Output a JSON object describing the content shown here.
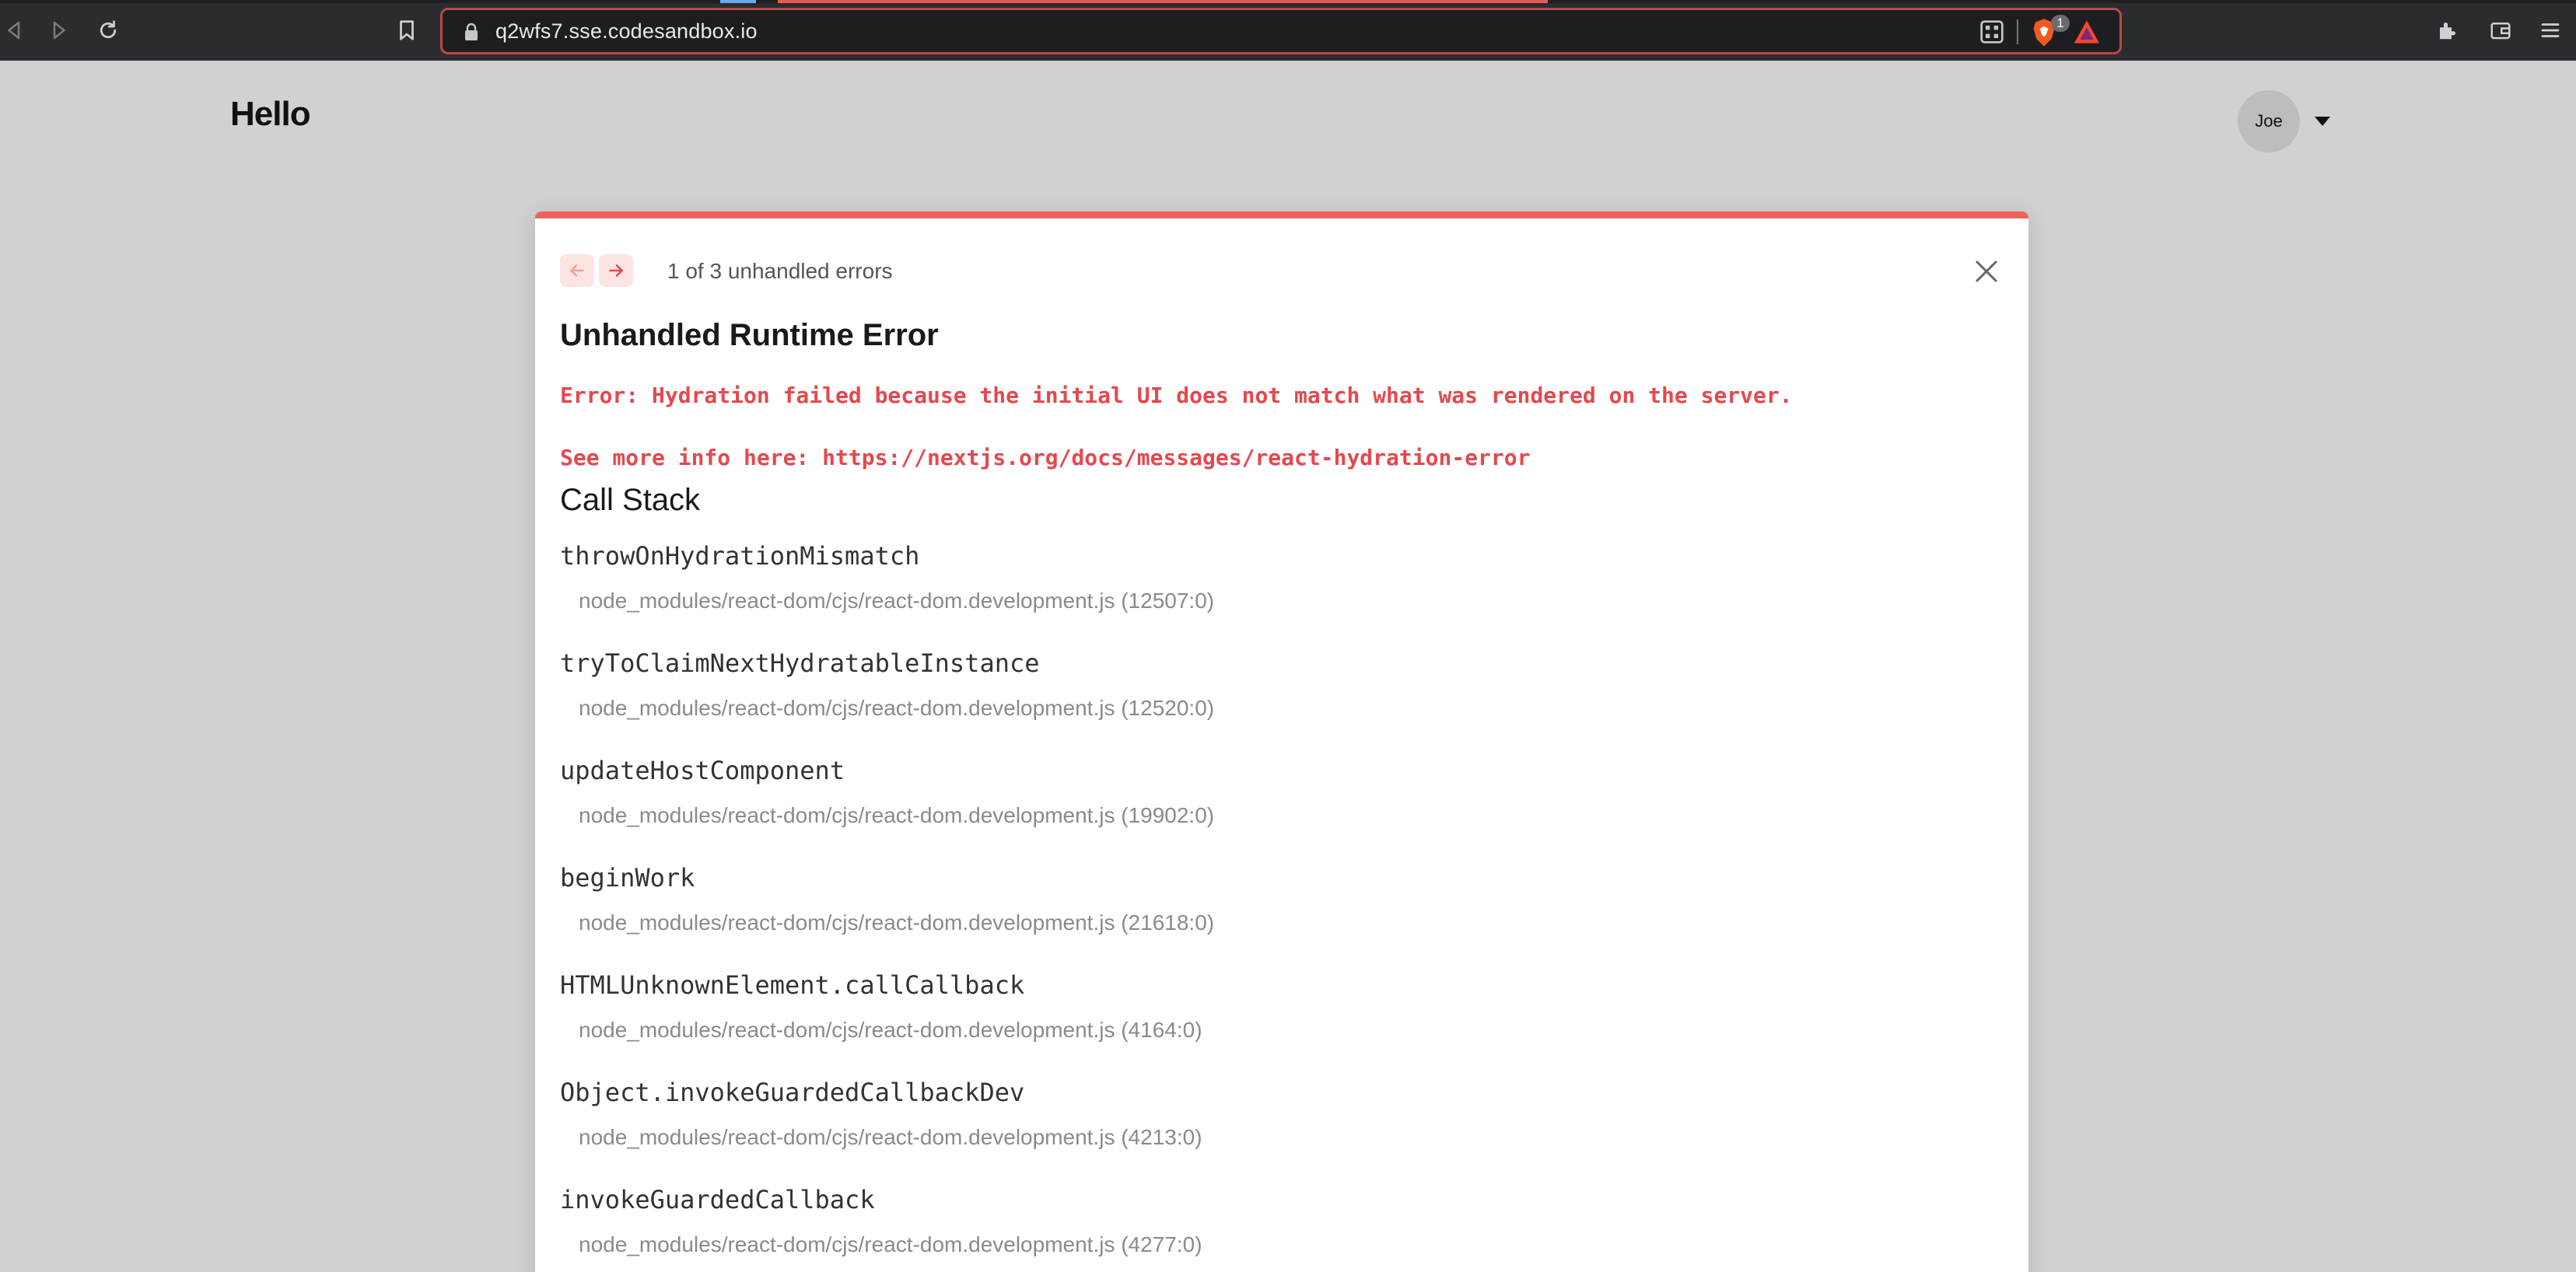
{
  "browser": {
    "url": "q2wfs7.sse.codesandbox.io",
    "shields_badge": "1"
  },
  "page": {
    "title": "Hello",
    "user": "Joe"
  },
  "error_overlay": {
    "count_text": "1 of 3 unhandled errors",
    "title": "Unhandled Runtime Error",
    "message": "Error: Hydration failed because the initial UI does not match what was rendered on the server.\nSee more info here: https://nextjs.org/docs/messages/react-hydration-error",
    "call_stack_title": "Call Stack",
    "frames": [
      {
        "fn": "throwOnHydrationMismatch",
        "file": "node_modules/react-dom/cjs/react-dom.development.js (12507:0)"
      },
      {
        "fn": "tryToClaimNextHydratableInstance",
        "file": "node_modules/react-dom/cjs/react-dom.development.js (12520:0)"
      },
      {
        "fn": "updateHostComponent",
        "file": "node_modules/react-dom/cjs/react-dom.development.js (19902:0)"
      },
      {
        "fn": "beginWork",
        "file": "node_modules/react-dom/cjs/react-dom.development.js (21618:0)"
      },
      {
        "fn": "HTMLUnknownElement.callCallback",
        "file": "node_modules/react-dom/cjs/react-dom.development.js (4164:0)"
      },
      {
        "fn": "Object.invokeGuardedCallbackDev",
        "file": "node_modules/react-dom/cjs/react-dom.development.js (4213:0)"
      },
      {
        "fn": "invokeGuardedCallback",
        "file": "node_modules/react-dom/cjs/react-dom.development.js (4277:0)"
      }
    ]
  },
  "colors": {
    "accent": "#f0625c",
    "error_text": "#e5484d"
  },
  "icons": [
    "back-icon",
    "forward-icon",
    "reload-icon",
    "bookmark-icon",
    "lock-icon",
    "qr-code-icon",
    "brave-shields-icon",
    "bat-rewards-icon",
    "extensions-icon",
    "wallet-icon",
    "menu-icon",
    "arrow-left-icon",
    "arrow-right-icon",
    "close-icon",
    "chevron-down-icon"
  ]
}
